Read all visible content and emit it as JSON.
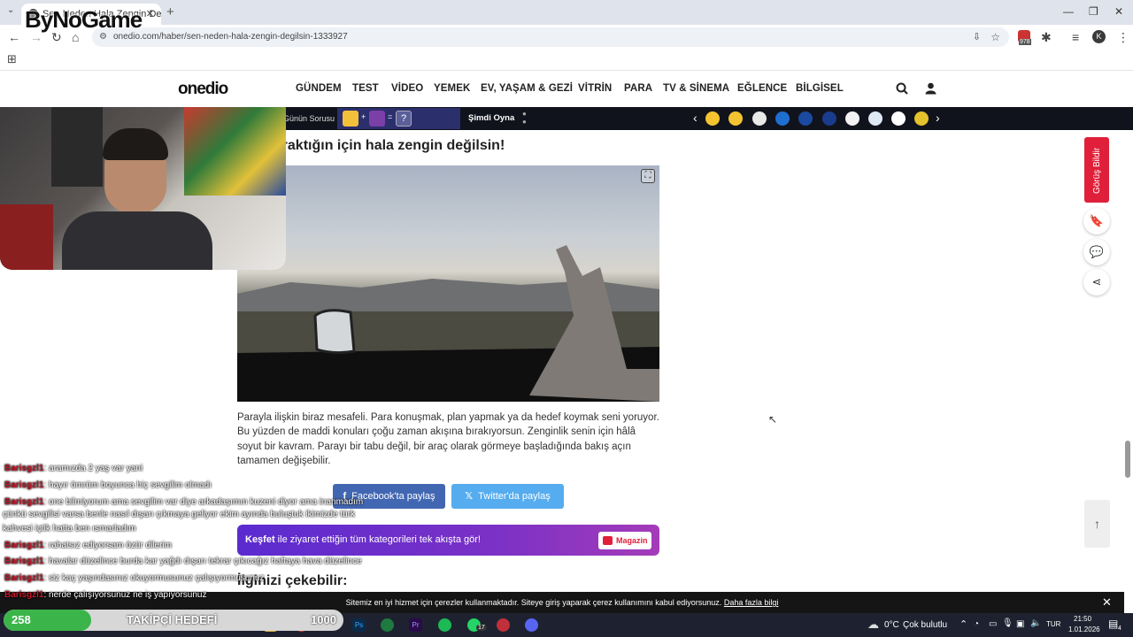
{
  "browser": {
    "tab_title": "Sen Neden Hala Zengin Değilsi",
    "new_tab": "+",
    "url": "onedio.com/haber/sen-neden-hala-zengin-degilsin-1333927",
    "profile_initial": "K",
    "extension_badge": "978"
  },
  "watermark": "ByNoGame",
  "site": {
    "logo": "onedio",
    "nav": [
      "GÜNDEM",
      "TEST",
      "VİDEO",
      "YEMEK",
      "EV, YAŞAM & GEZİ",
      "VİTRİN",
      "PARA",
      "TV & SİNEMA",
      "EĞLENCE",
      "BİLGİSEL"
    ]
  },
  "strip": {
    "label": "Günün Sorusu",
    "equation_ops": [
      "+",
      "=",
      "?"
    ],
    "cta": "Şimdi Oyna",
    "prev": "‹",
    "next": "›"
  },
  "article": {
    "title": "şına bıraktığın için hala zengin değilsin!",
    "paragraph": "Parayla ilişkin biraz mesafeli. Para konuşmak, plan yapmak ya da hedef koymak seni yoruyor. Bu yüzden de maddi konuları çoğu zaman akışına bırakıyorsun. Zenginlik senin için hâlâ soyut bir kavram. Parayı bir tabu değil, bir araç olarak görmeye başladığında bakış açın tamamen değişebilir.",
    "share_facebook": "Facebook'ta paylaş",
    "share_twitter": "Twitter'da paylaş",
    "banner_bold": "Keşfet",
    "banner_text": " ile ziyaret ettiğin tüm kategorileri tek akışta gör!",
    "banner_badge": "Magazin",
    "section_title": "İlginizi çekebilir:"
  },
  "rail": {
    "feedback": "Görüş Bildir",
    "to_top": "↑"
  },
  "chat": [
    {
      "user": "Barisgzl1",
      "msg": ": aramızda 2 yaş var yani"
    },
    {
      "user": "Barisgzl1",
      "msg": ": hayır ömrüm boyunca hiç sevgilim olmadı"
    },
    {
      "user": "Barisgzl1",
      "msg": ": one bilmiyorum ama sevgilim var diye arkadaşımın kuzeni diyor ama inanmadım"
    },
    {
      "user": "",
      "msg": "çünkü sevgilisi varsa benle nasıl dışarı çıkmaya geliyor ekim ayında buluştuk ikimizde türk"
    },
    {
      "user": "",
      "msg": "kahvesi içtik hatta ben ısmarladım"
    },
    {
      "user": "Barisgzl1",
      "msg": ": rahatsız ediyorsam özür dilerim"
    },
    {
      "user": "Barisgzl1",
      "msg": ": havalar düzelince burda kar yağdı dışarı tekrar çıkıcağız haftaya hava düzelince"
    },
    {
      "user": "Barisgzl1",
      "msg": ": siz kaç yaşındasınız okuyormusunuz çalışıyormusunuz"
    },
    {
      "user": "Barisgzl1",
      "msg": ": nerde çalışıyorsunuz ne iş yapıyorsunuz"
    }
  ],
  "cookie": {
    "text": "Sitemiz en iyi hizmet için çerezler kullanmaktadır. Siteye giriş yaparak çerez kullanımını kabul ediyorsunuz.",
    "link": "Daha fazla bilgi",
    "close": "✕"
  },
  "follower_goal": {
    "current": "258",
    "label": "TAKİPÇİ HEDEFİ",
    "target": "1000",
    "progress": 0.258
  },
  "taskbar": {
    "weather_temp": "0°C",
    "weather_desc": "Çok bulutlu",
    "lang": "TUR",
    "time": "21:50",
    "date": "1.01.2026",
    "notifications": "4",
    "whatsapp_badge": "17"
  },
  "colors": {
    "facebook": "#4267b2",
    "twitter": "#55acee",
    "feedback": "#e0203a",
    "goal_fill": "#3bb54a",
    "chat_user": "#c01a2a"
  }
}
